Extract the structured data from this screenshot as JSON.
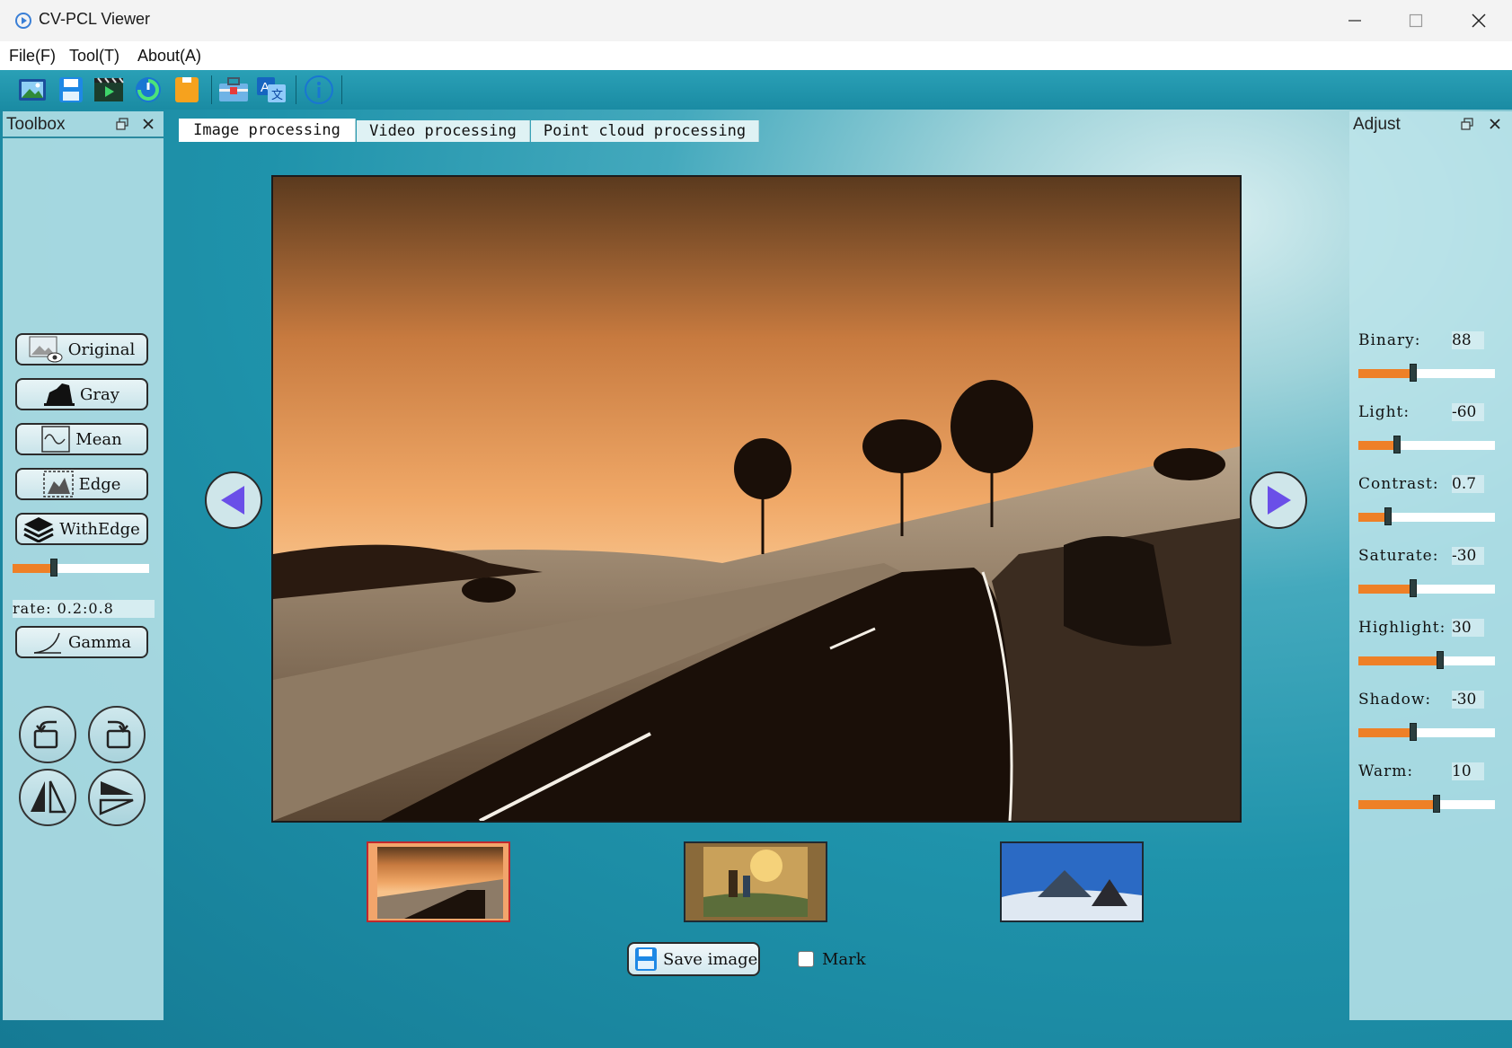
{
  "window": {
    "title": "CV-PCL Viewer"
  },
  "menu": {
    "items": [
      "File(F)",
      "Tool(T)",
      "About(A)"
    ]
  },
  "toolbox": {
    "title": "Toolbox",
    "buttons": {
      "original": "Original",
      "gray": "Gray",
      "mean": "Mean",
      "edge": "Edge",
      "withedge": "WithEdge",
      "gamma": "Gamma"
    },
    "rate_label": "rate: 0.2:0.8",
    "rate_value": 0.3
  },
  "tabs": [
    "Image processing",
    "Video processing",
    "Point cloud processing"
  ],
  "adjust": {
    "title": "Adjust",
    "params": [
      {
        "label": "Binary:",
        "value": "88",
        "level": 0.4
      },
      {
        "label": "Light:",
        "value": "-60",
        "level": 0.28
      },
      {
        "label": "Contrast:",
        "value": "0.7",
        "level": 0.22
      },
      {
        "label": "Saturate:",
        "value": "-30",
        "level": 0.4
      },
      {
        "label": "Highlight:",
        "value": "30",
        "level": 0.6
      },
      {
        "label": "Shadow:",
        "value": "-30",
        "level": 0.4
      },
      {
        "label": "Warm:",
        "value": "10",
        "level": 0.57
      }
    ]
  },
  "bottom": {
    "save_label": "Save image",
    "mark_label": "Mark",
    "mark_checked": false
  },
  "colors": {
    "accent_orange": "#ee8027",
    "nav_purple": "#6a4fe8",
    "selected_border": "#c0282d"
  }
}
